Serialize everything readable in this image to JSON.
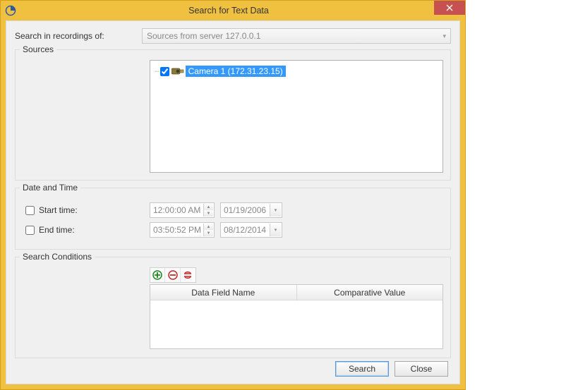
{
  "window": {
    "title": "Search for Text Data"
  },
  "searchIn": {
    "label": "Search in recordings of:",
    "value": "Sources from server 127.0.0.1"
  },
  "sourcesGroup": {
    "legend": "Sources",
    "items": [
      {
        "label": "Camera 1 (172.31.23.15)",
        "checked": true,
        "selected": true
      }
    ]
  },
  "dateTimeGroup": {
    "legend": "Date and Time",
    "start": {
      "label": "Start time:",
      "checked": false,
      "time": "12:00:00 AM",
      "date": "01/19/2006"
    },
    "end": {
      "label": "End time:",
      "checked": false,
      "time": "03:50:52 PM",
      "date": "08/12/2014"
    }
  },
  "conditionsGroup": {
    "legend": "Search Conditions",
    "columns": [
      "Data Field Name",
      "Comparative Value"
    ]
  },
  "buttons": {
    "search": "Search",
    "close": "Close"
  }
}
